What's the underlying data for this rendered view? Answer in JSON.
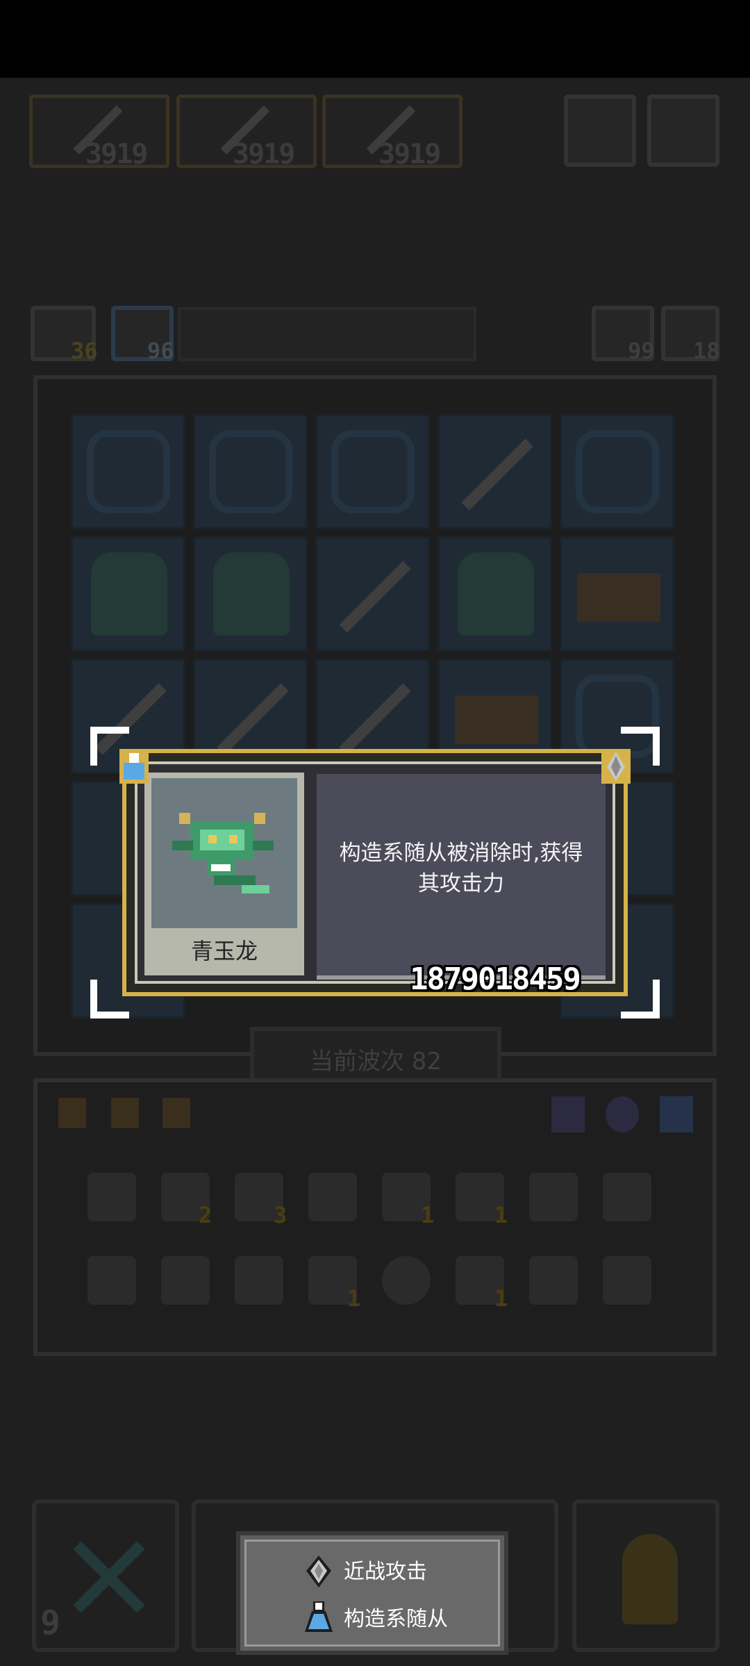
{
  "top_weapons": {
    "slots": [
      {
        "value": "3919",
        "icon": "sword-icon"
      },
      {
        "value": "3919",
        "icon": "sword-icon"
      },
      {
        "value": "3919",
        "icon": "sword-icon"
      }
    ]
  },
  "counters": {
    "left_a": "36",
    "left_b": "96",
    "right_a": "99",
    "right_b": "18"
  },
  "wave": {
    "label": "当前波次 82"
  },
  "card": {
    "name": "青玉龙",
    "description_line1": "构造系随从被消除时,获得",
    "description_line2": "其攻击力",
    "power": "1879018459",
    "type_icon": "flask-icon",
    "attack_icon": "spearhead-icon"
  },
  "inventory_badges": [
    "2",
    "3",
    "1",
    "1",
    "1",
    "1"
  ],
  "bottom": {
    "left_count": "9"
  },
  "tooltip": {
    "row1": "近战攻击",
    "row2": "构造系随从"
  },
  "colors": {
    "card_border": "#d6b24a",
    "description_bg": "#4c4b5a",
    "flask_blue": "#5aa9e6",
    "power_text": "#ffffff"
  }
}
